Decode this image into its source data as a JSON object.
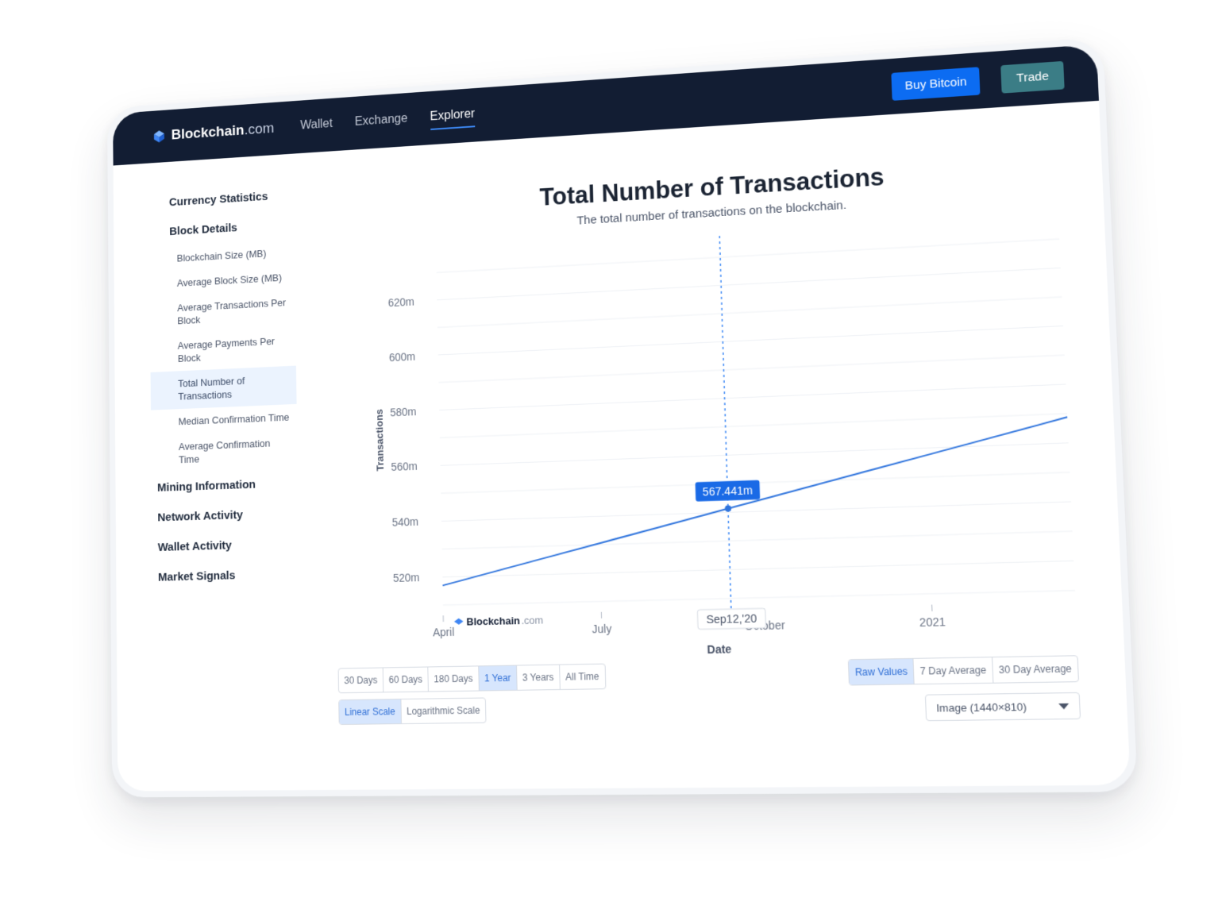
{
  "brand": {
    "name": "Blockchain",
    "suffix": ".com"
  },
  "nav": {
    "items": [
      "Wallet",
      "Exchange",
      "Explorer"
    ],
    "active": "Explorer"
  },
  "header_buttons": {
    "buy": "Buy Bitcoin",
    "trade": "Trade"
  },
  "sidebar": {
    "currency": "Currency Statistics",
    "block": "Block Details",
    "block_items": [
      "Blockchain Size (MB)",
      "Average Block Size (MB)",
      "Average Transactions Per Block",
      "Average Payments Per Block",
      "Total Number of Transactions",
      "Median Confirmation Time",
      "Average Confirmation Time"
    ],
    "active_item": "Total Number of Transactions",
    "mining": "Mining Information",
    "network": "Network Activity",
    "wallet": "Wallet Activity",
    "market": "Market Signals"
  },
  "chart": {
    "title": "Total Number of Transactions",
    "subtitle": "The total number of transactions on the blockchain.",
    "watermark_brand": "Blockchain",
    "watermark_suffix": ".com"
  },
  "chart_data": {
    "type": "line",
    "title": "Total Number of Transactions",
    "subtitle": "The total number of transactions on the blockchain.",
    "xlabel": "Date",
    "ylabel": "Transactions",
    "x_ticks": [
      "April",
      "July",
      "October",
      "2021"
    ],
    "y_ticks": [
      "520m",
      "540m",
      "560m",
      "580m",
      "600m",
      "620m"
    ],
    "y_tick_values": [
      520,
      540,
      560,
      580,
      600,
      620
    ],
    "ylim": [
      508,
      632
    ],
    "x_tick_months": [
      0,
      3,
      6,
      9
    ],
    "xlim_months": [
      0,
      11.5
    ],
    "series": [
      {
        "x_months": [
          0,
          1,
          2,
          3,
          4,
          5,
          5.4,
          6,
          7,
          8,
          9,
          10,
          11,
          11.5
        ],
        "values": [
          517,
          521.5,
          526,
          530.5,
          535,
          539.5,
          541.3,
          544,
          548.5,
          553,
          557.5,
          562,
          566.5,
          568.8
        ]
      }
    ],
    "grid": true,
    "tooltip": {
      "date": "Sep12,'20",
      "value": "567.441m",
      "x_month": 5.4,
      "y": 541.3
    },
    "color": "#2f74dd"
  },
  "controls": {
    "ranges": [
      "30 Days",
      "60 Days",
      "180 Days",
      "1 Year",
      "3 Years",
      "All Time"
    ],
    "active_range": "1 Year",
    "scales": [
      "Linear Scale",
      "Logarithmic Scale"
    ],
    "active_scale": "Linear Scale",
    "averages": [
      "Raw Values",
      "7 Day Average",
      "30 Day Average"
    ],
    "active_average": "Raw Values",
    "export": "Image (1440×810)"
  },
  "colors": {
    "topbar": "#121d33",
    "primary": "#0c6cf2",
    "trade": "#3b7d86",
    "line": "#2f74dd"
  }
}
